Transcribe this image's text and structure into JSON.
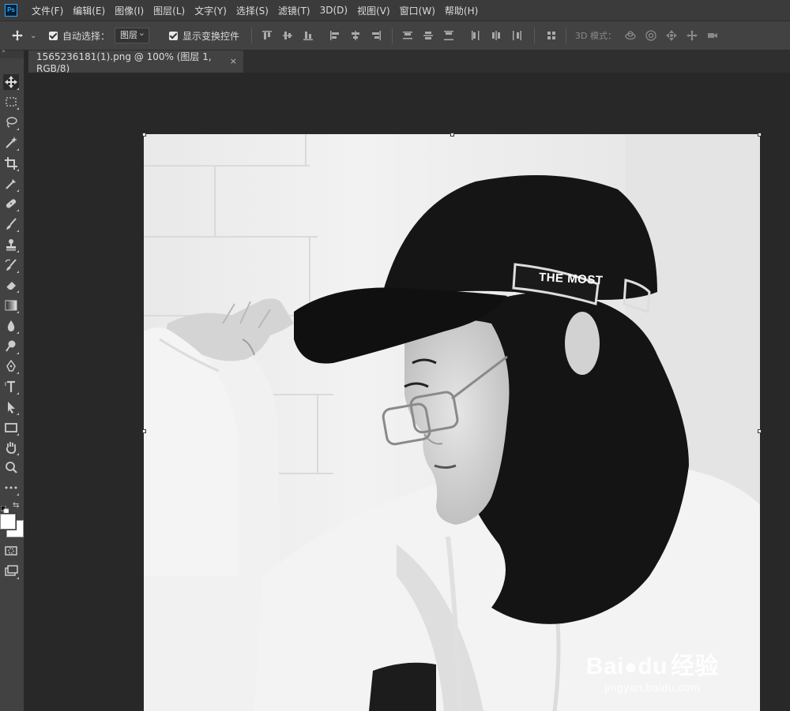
{
  "app": {
    "logo": "Ps",
    "accent": "#31a8ff"
  },
  "menu": [
    "文件(F)",
    "编辑(E)",
    "图像(I)",
    "图层(L)",
    "文字(Y)",
    "选择(S)",
    "滤镜(T)",
    "3D(D)",
    "视图(V)",
    "窗口(W)",
    "帮助(H)"
  ],
  "options": {
    "auto_select_label": "自动选择：",
    "auto_select_value": "图层",
    "show_transform_label": "显示变换控件",
    "mode_3d_label": "3D 模式："
  },
  "document": {
    "tab_title": "1565236181(1).png @ 100% (图层 1, RGB/8)",
    "close": "×"
  },
  "cap_text": "THE MOST",
  "watermark": {
    "brand": "Bai",
    "brand2": "du",
    "cn": "经验",
    "url": "jingyan.baidu.com"
  },
  "tools": [
    "move-icon",
    "marquee-icon",
    "lasso-icon",
    "magic-wand-icon",
    "crop-icon",
    "eyedropper-icon",
    "healing-brush-icon",
    "brush-icon",
    "stamp-icon",
    "history-brush-icon",
    "eraser-icon",
    "gradient-icon",
    "blur-icon",
    "dodge-icon",
    "pen-icon",
    "type-icon",
    "path-select-icon",
    "rectangle-icon",
    "hand-icon",
    "zoom-icon",
    "more-icon"
  ]
}
